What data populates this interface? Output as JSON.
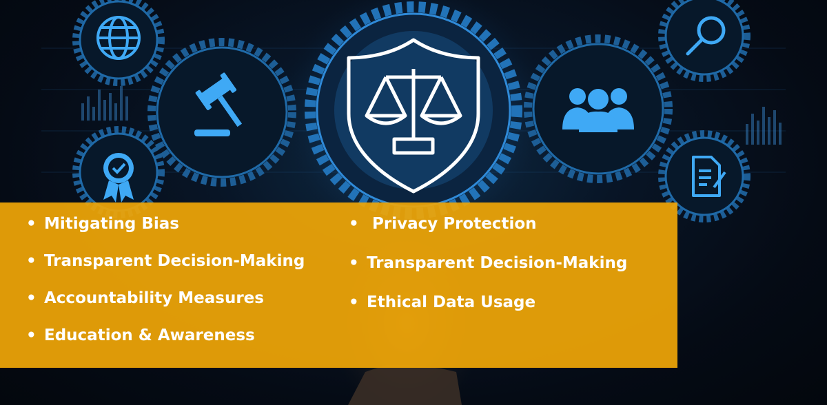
{
  "left_list": [
    {
      "label": "Mitigating Bias"
    },
    {
      "label": "Transparent Decision-Making"
    },
    {
      "label": "Accountability Measures"
    },
    {
      "label": "Education & Awareness"
    }
  ],
  "right_list": [
    {
      "label": "Privacy Protection"
    },
    {
      "label": "Transparent Decision-Making"
    },
    {
      "label": "Ethical Data Usage"
    }
  ],
  "bullet": "•",
  "colors": {
    "panel": "#EFA608",
    "glow": "#3FA9F5",
    "background": "#050B15"
  },
  "icons": [
    "globe-icon",
    "gavel-icon",
    "award-badge-icon",
    "shield-scales-icon",
    "magnifier-icon",
    "people-icon",
    "document-icon"
  ]
}
